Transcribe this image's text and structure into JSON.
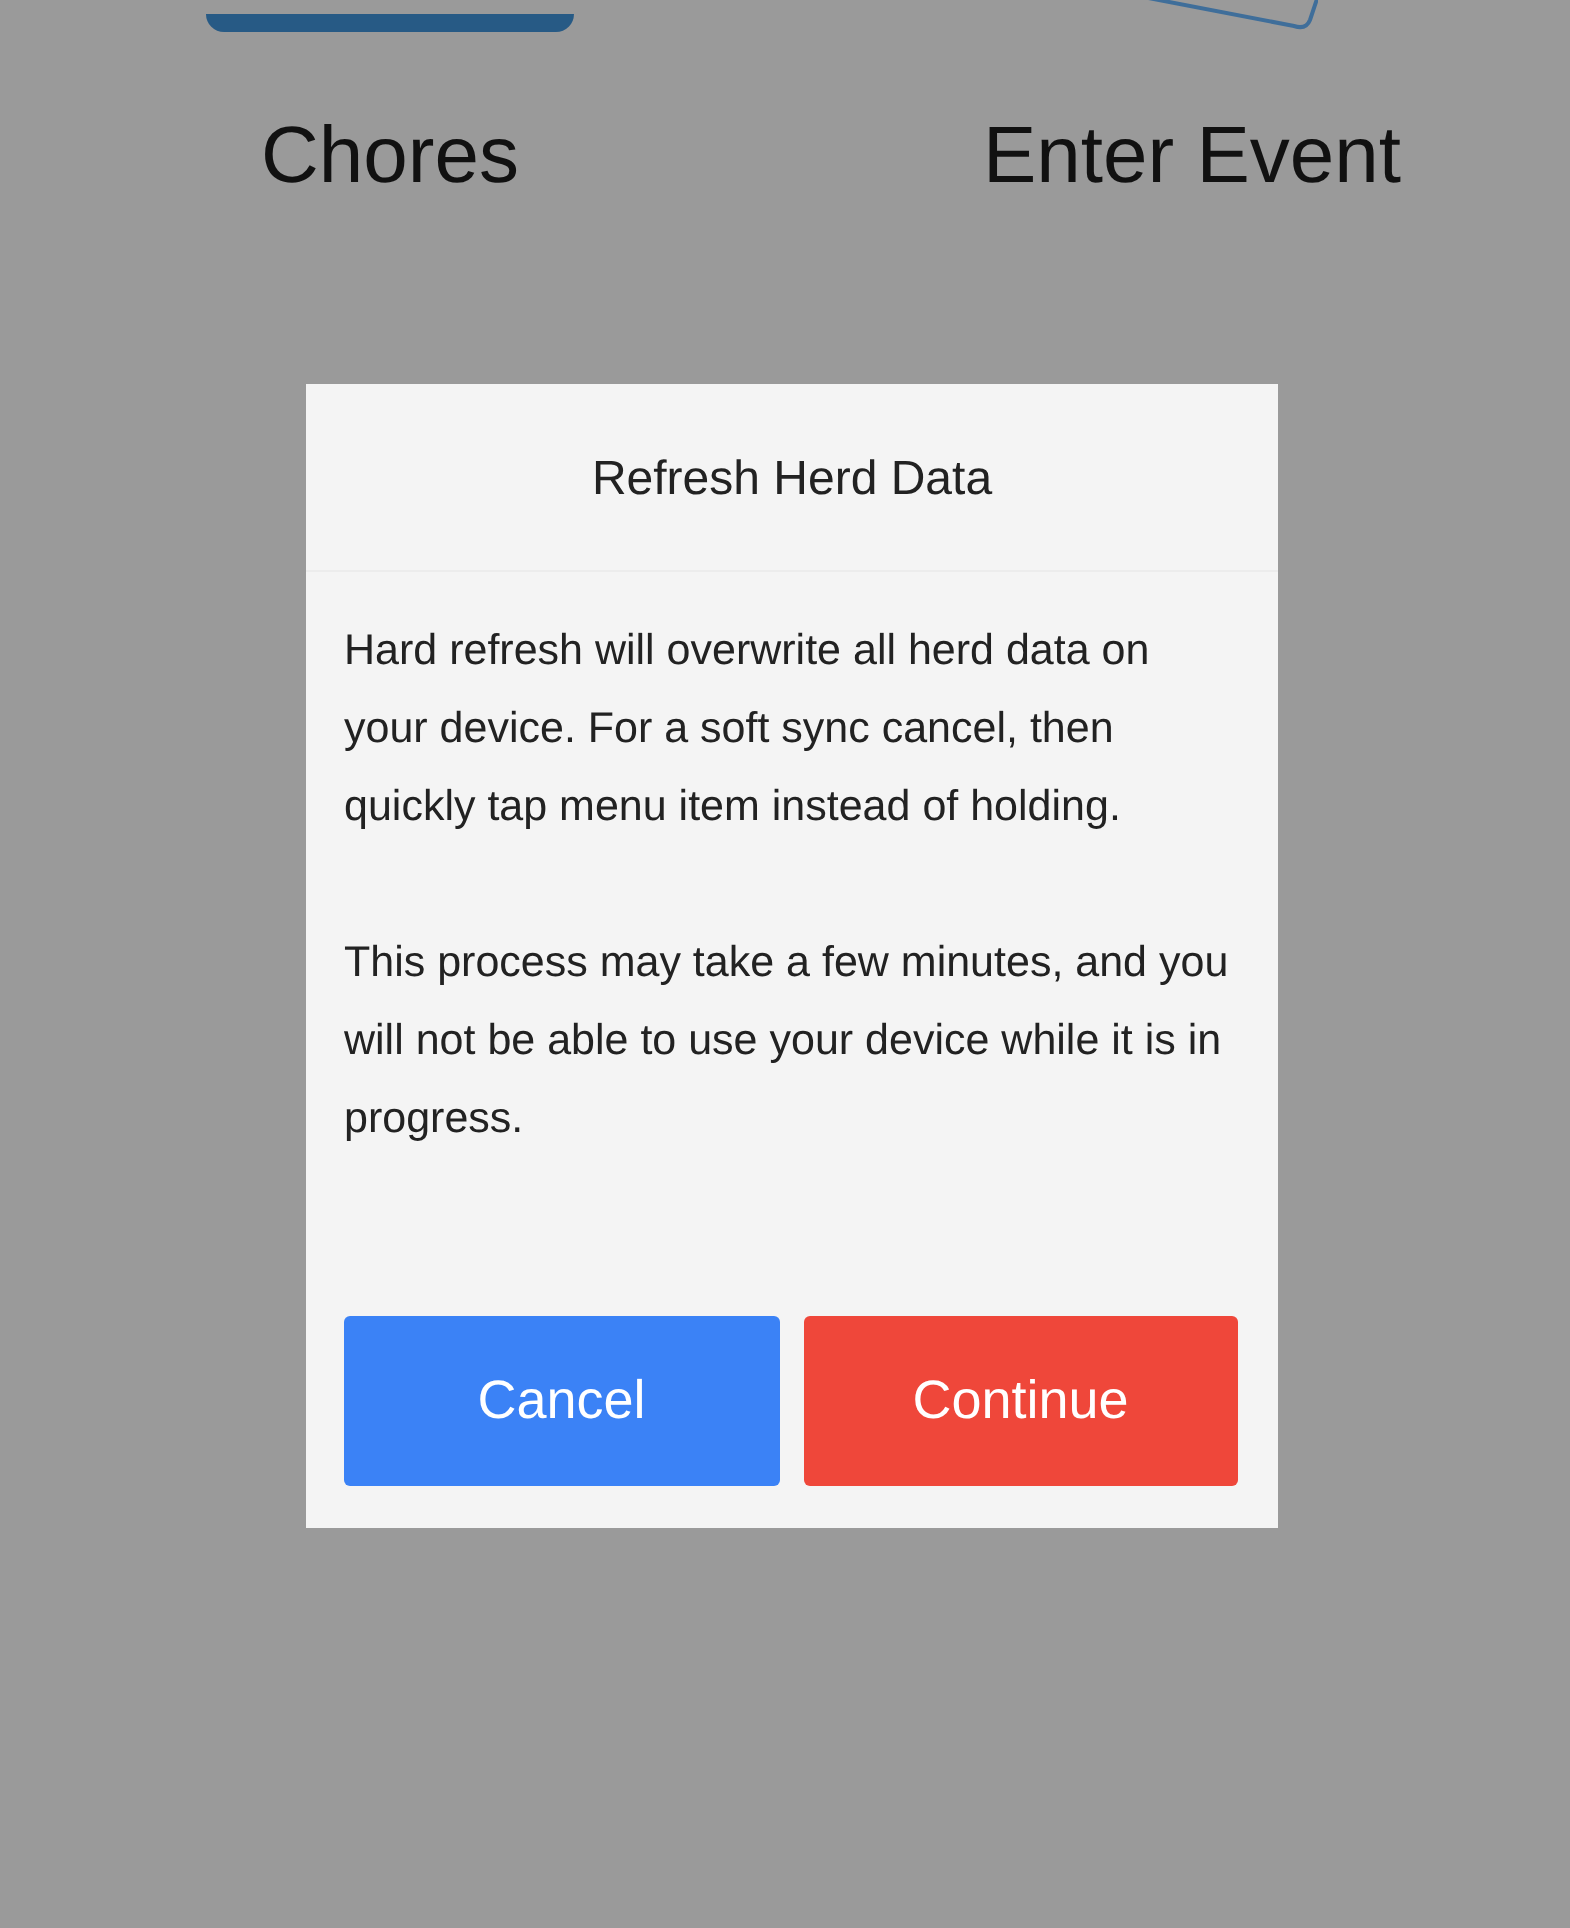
{
  "home_tiles": [
    {
      "label": "Chores",
      "kind": "filled"
    },
    {
      "label": "Enter Event",
      "kind": "outline"
    }
  ],
  "dialog": {
    "title": "Refresh Herd Data",
    "paragraphs": [
      "Hard refresh will overwrite all herd data on your device. For a soft sync cancel, then quickly tap menu item instead of holding.",
      "This process may take a few minutes, and you will not be able to use your device while it is in progress."
    ],
    "buttons": [
      {
        "label": "Cancel",
        "kind": "secondary"
      },
      {
        "label": "Continue",
        "kind": "danger"
      }
    ]
  }
}
